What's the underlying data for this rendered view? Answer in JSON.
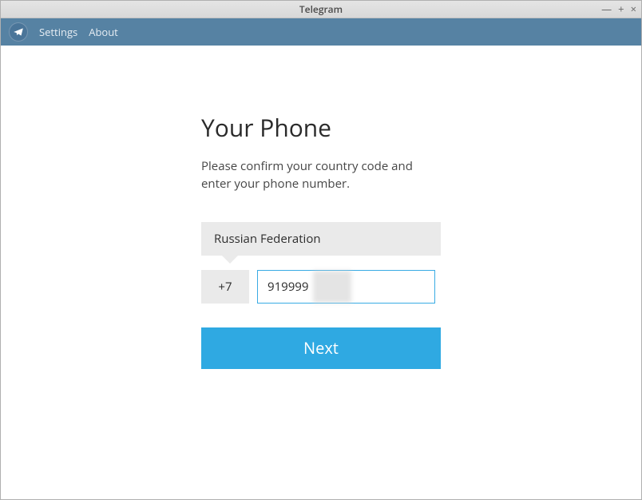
{
  "window": {
    "title": "Telegram"
  },
  "menubar": {
    "settings": "Settings",
    "about": "About"
  },
  "login": {
    "heading": "Your Phone",
    "subtext": "Please confirm your country code and enter your phone number.",
    "country": "Russian Federation",
    "dial_code": "+7",
    "phone_value": "919999",
    "next_label": "Next"
  }
}
